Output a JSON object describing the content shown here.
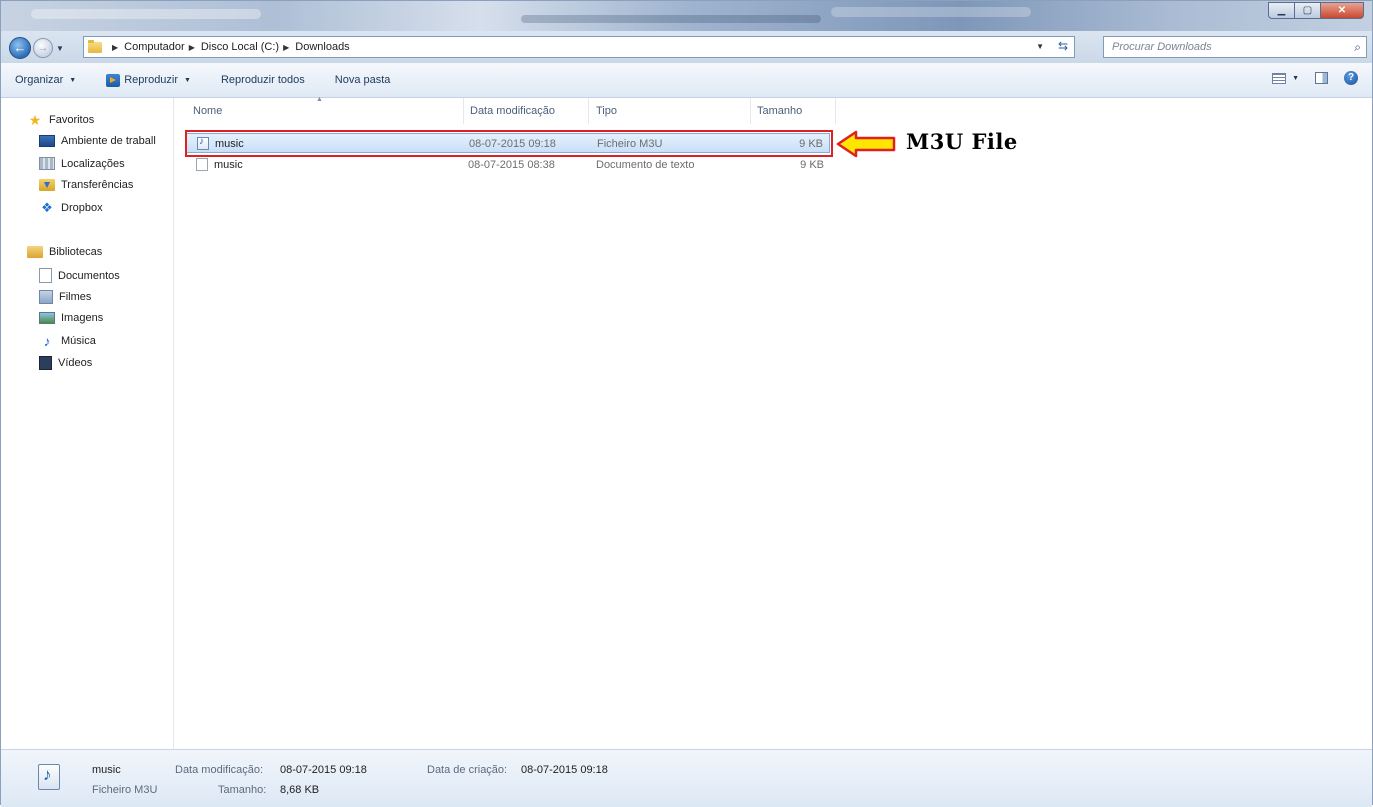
{
  "address": {
    "crumbs": [
      "Computador",
      "Disco Local (C:)",
      "Downloads"
    ],
    "search_placeholder": "Procurar Downloads"
  },
  "toolbar": {
    "organize": "Organizar",
    "play": "Reproduzir",
    "play_all": "Reproduzir todos",
    "new_folder": "Nova pasta"
  },
  "nav": {
    "favorites_header": "Favoritos",
    "favorites": [
      "Ambiente de traball",
      "Localizações",
      "Transferências",
      "Dropbox"
    ],
    "libraries_header": "Bibliotecas",
    "libraries": [
      "Documentos",
      "Filmes",
      "Imagens",
      "Música",
      "Vídeos"
    ]
  },
  "columns": [
    "Nome",
    "Data modificação",
    "Tipo",
    "Tamanho"
  ],
  "files": [
    {
      "name": "music",
      "modified": "08-07-2015 09:18",
      "type": "Ficheiro M3U",
      "size": "9 KB",
      "icon": "m3u-file-icon",
      "selected": true
    },
    {
      "name": "music",
      "modified": "08-07-2015 08:38",
      "type": "Documento de texto",
      "size": "9 KB",
      "icon": "text-file-icon",
      "selected": false
    }
  ],
  "annotation": {
    "label": "M3U File",
    "color": "#e0201f",
    "arrow_fill": "#ffe600"
  },
  "details": {
    "name": "music",
    "type": "Ficheiro M3U",
    "modified_label": "Data modificação:",
    "modified_value": "08-07-2015 09:18",
    "created_label": "Data de criação:",
    "created_value": "08-07-2015 09:18",
    "size_label": "Tamanho:",
    "size_value": "8,68 KB"
  }
}
